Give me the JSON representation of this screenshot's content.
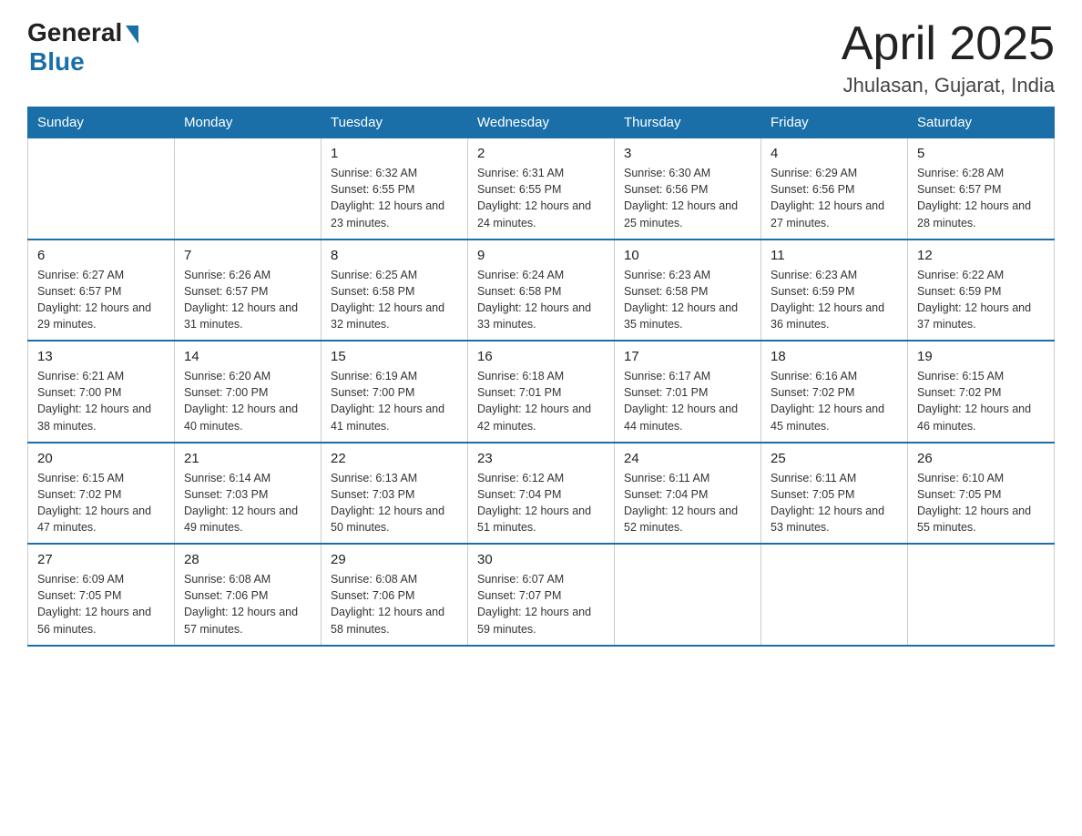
{
  "logo": {
    "general": "General",
    "blue": "Blue"
  },
  "title": {
    "month_year": "April 2025",
    "location": "Jhulasan, Gujarat, India"
  },
  "days_of_week": [
    "Sunday",
    "Monday",
    "Tuesday",
    "Wednesday",
    "Thursday",
    "Friday",
    "Saturday"
  ],
  "weeks": [
    [
      {
        "day": "",
        "info": ""
      },
      {
        "day": "",
        "info": ""
      },
      {
        "day": "1",
        "info": "Sunrise: 6:32 AM\nSunset: 6:55 PM\nDaylight: 12 hours\nand 23 minutes."
      },
      {
        "day": "2",
        "info": "Sunrise: 6:31 AM\nSunset: 6:55 PM\nDaylight: 12 hours\nand 24 minutes."
      },
      {
        "day": "3",
        "info": "Sunrise: 6:30 AM\nSunset: 6:56 PM\nDaylight: 12 hours\nand 25 minutes."
      },
      {
        "day": "4",
        "info": "Sunrise: 6:29 AM\nSunset: 6:56 PM\nDaylight: 12 hours\nand 27 minutes."
      },
      {
        "day": "5",
        "info": "Sunrise: 6:28 AM\nSunset: 6:57 PM\nDaylight: 12 hours\nand 28 minutes."
      }
    ],
    [
      {
        "day": "6",
        "info": "Sunrise: 6:27 AM\nSunset: 6:57 PM\nDaylight: 12 hours\nand 29 minutes."
      },
      {
        "day": "7",
        "info": "Sunrise: 6:26 AM\nSunset: 6:57 PM\nDaylight: 12 hours\nand 31 minutes."
      },
      {
        "day": "8",
        "info": "Sunrise: 6:25 AM\nSunset: 6:58 PM\nDaylight: 12 hours\nand 32 minutes."
      },
      {
        "day": "9",
        "info": "Sunrise: 6:24 AM\nSunset: 6:58 PM\nDaylight: 12 hours\nand 33 minutes."
      },
      {
        "day": "10",
        "info": "Sunrise: 6:23 AM\nSunset: 6:58 PM\nDaylight: 12 hours\nand 35 minutes."
      },
      {
        "day": "11",
        "info": "Sunrise: 6:23 AM\nSunset: 6:59 PM\nDaylight: 12 hours\nand 36 minutes."
      },
      {
        "day": "12",
        "info": "Sunrise: 6:22 AM\nSunset: 6:59 PM\nDaylight: 12 hours\nand 37 minutes."
      }
    ],
    [
      {
        "day": "13",
        "info": "Sunrise: 6:21 AM\nSunset: 7:00 PM\nDaylight: 12 hours\nand 38 minutes."
      },
      {
        "day": "14",
        "info": "Sunrise: 6:20 AM\nSunset: 7:00 PM\nDaylight: 12 hours\nand 40 minutes."
      },
      {
        "day": "15",
        "info": "Sunrise: 6:19 AM\nSunset: 7:00 PM\nDaylight: 12 hours\nand 41 minutes."
      },
      {
        "day": "16",
        "info": "Sunrise: 6:18 AM\nSunset: 7:01 PM\nDaylight: 12 hours\nand 42 minutes."
      },
      {
        "day": "17",
        "info": "Sunrise: 6:17 AM\nSunset: 7:01 PM\nDaylight: 12 hours\nand 44 minutes."
      },
      {
        "day": "18",
        "info": "Sunrise: 6:16 AM\nSunset: 7:02 PM\nDaylight: 12 hours\nand 45 minutes."
      },
      {
        "day": "19",
        "info": "Sunrise: 6:15 AM\nSunset: 7:02 PM\nDaylight: 12 hours\nand 46 minutes."
      }
    ],
    [
      {
        "day": "20",
        "info": "Sunrise: 6:15 AM\nSunset: 7:02 PM\nDaylight: 12 hours\nand 47 minutes."
      },
      {
        "day": "21",
        "info": "Sunrise: 6:14 AM\nSunset: 7:03 PM\nDaylight: 12 hours\nand 49 minutes."
      },
      {
        "day": "22",
        "info": "Sunrise: 6:13 AM\nSunset: 7:03 PM\nDaylight: 12 hours\nand 50 minutes."
      },
      {
        "day": "23",
        "info": "Sunrise: 6:12 AM\nSunset: 7:04 PM\nDaylight: 12 hours\nand 51 minutes."
      },
      {
        "day": "24",
        "info": "Sunrise: 6:11 AM\nSunset: 7:04 PM\nDaylight: 12 hours\nand 52 minutes."
      },
      {
        "day": "25",
        "info": "Sunrise: 6:11 AM\nSunset: 7:05 PM\nDaylight: 12 hours\nand 53 minutes."
      },
      {
        "day": "26",
        "info": "Sunrise: 6:10 AM\nSunset: 7:05 PM\nDaylight: 12 hours\nand 55 minutes."
      }
    ],
    [
      {
        "day": "27",
        "info": "Sunrise: 6:09 AM\nSunset: 7:05 PM\nDaylight: 12 hours\nand 56 minutes."
      },
      {
        "day": "28",
        "info": "Sunrise: 6:08 AM\nSunset: 7:06 PM\nDaylight: 12 hours\nand 57 minutes."
      },
      {
        "day": "29",
        "info": "Sunrise: 6:08 AM\nSunset: 7:06 PM\nDaylight: 12 hours\nand 58 minutes."
      },
      {
        "day": "30",
        "info": "Sunrise: 6:07 AM\nSunset: 7:07 PM\nDaylight: 12 hours\nand 59 minutes."
      },
      {
        "day": "",
        "info": ""
      },
      {
        "day": "",
        "info": ""
      },
      {
        "day": "",
        "info": ""
      }
    ]
  ]
}
